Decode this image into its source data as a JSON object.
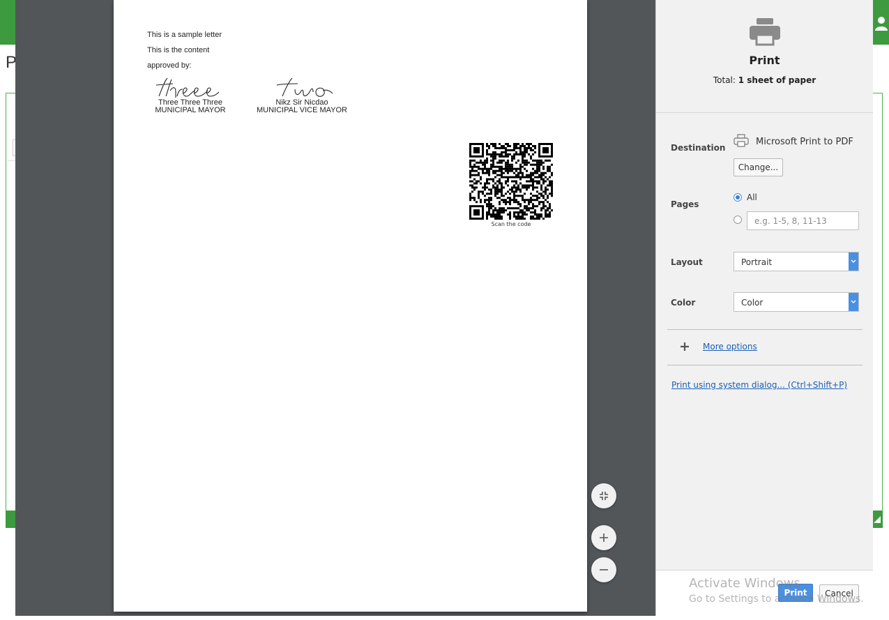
{
  "background_app": {
    "title_fragment": "P"
  },
  "document": {
    "lines": [
      "This is a sample letter",
      "This is the content",
      "approved by:"
    ],
    "signatories": [
      {
        "signature": "three",
        "name": "Three Three Three",
        "position": "MUNICIPAL MAYOR"
      },
      {
        "signature": "two",
        "name": "Nikz Sir Nicdao",
        "position": "MUNICIPAL VICE MAYOR"
      }
    ],
    "qr_label": "Scan the code"
  },
  "zoom_controls": {
    "fit_icon": "fit-to-page-icon",
    "zoom_in_icon": "zoom-in-icon",
    "zoom_out_icon": "zoom-out-icon"
  },
  "print_panel": {
    "title": "Print",
    "total_prefix": "Total: ",
    "total_value": "1 sheet of paper",
    "destination": {
      "label": "Destination",
      "printer_name": "Microsoft Print to PDF",
      "change_button": "Change..."
    },
    "pages": {
      "label": "Pages",
      "all_option": "All",
      "custom_placeholder": "e.g. 1-5, 8, 11-13"
    },
    "layout": {
      "label": "Layout",
      "value": "Portrait"
    },
    "color": {
      "label": "Color",
      "value": "Color"
    },
    "more_options": "More options",
    "system_dialog_link": "Print using system dialog... (Ctrl+Shift+P)",
    "print_button": "Print",
    "cancel_button": "Cancel"
  },
  "watermark": {
    "line1": "Activate Windows",
    "line2": "Go to Settings to activate Windows."
  },
  "colors": {
    "app_green": "#3d9a3f",
    "preview_bg": "#525659",
    "accent_blue": "#4a90e2"
  }
}
